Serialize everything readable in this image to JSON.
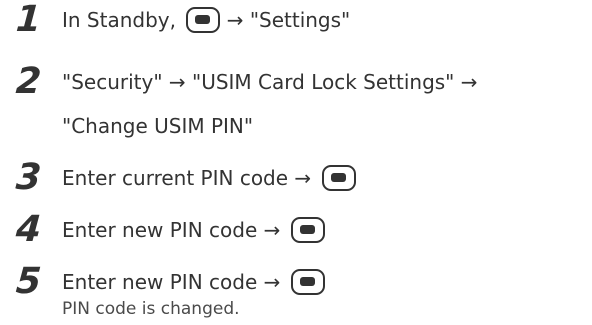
{
  "steps": [
    {
      "number": "1",
      "before": "In Standby,",
      "key_icon": "center-key-icon",
      "after": "→ \"Settings\""
    },
    {
      "number": "2",
      "line1": "\"Security\" → \"USIM Card Lock Settings\" →",
      "line2": "\"Change USIM PIN\""
    },
    {
      "number": "3",
      "before": "Enter current PIN code →",
      "key_icon": "center-key-icon"
    },
    {
      "number": "4",
      "before": "Enter new PIN code →",
      "key_icon": "center-key-icon"
    },
    {
      "number": "5",
      "before": "Enter new PIN code →",
      "key_icon": "center-key-icon",
      "note": "PIN code is changed."
    }
  ],
  "colors": {
    "text": "#333333",
    "note": "#4a4a4a"
  }
}
